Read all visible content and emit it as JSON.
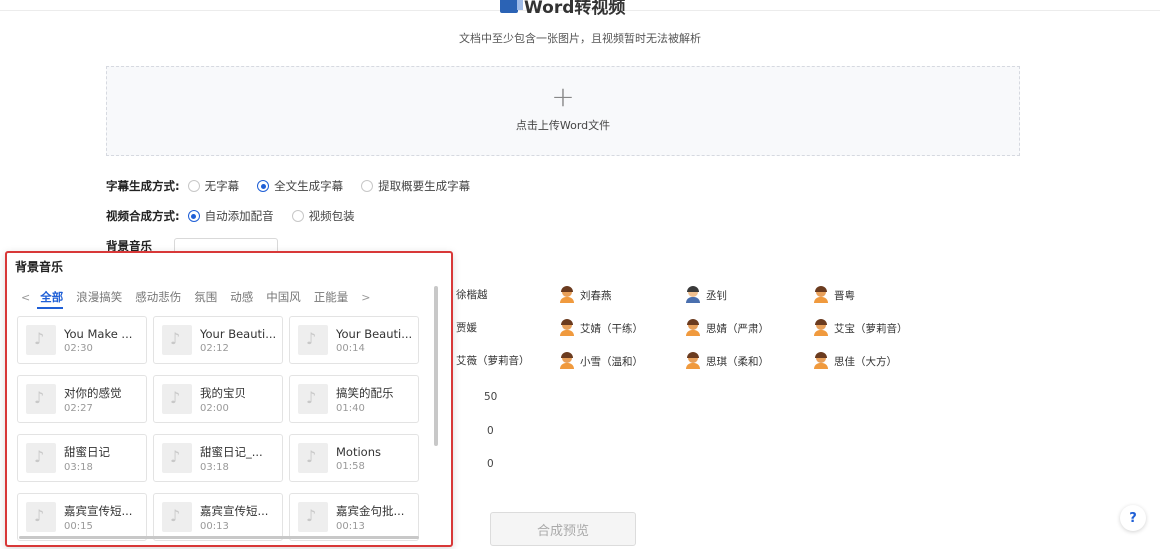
{
  "header": {
    "title": "Word转视频",
    "subtitle": "文档中至少包含一张图片，且视频暂时无法被解析"
  },
  "upload": {
    "plus": "+",
    "label": "点击上传Word文件"
  },
  "subtitle_mode": {
    "label": "字幕生成方式:",
    "options": [
      "无字幕",
      "全文生成字幕",
      "提取概要生成字幕"
    ],
    "selected": "全文生成字幕"
  },
  "video_mode": {
    "label": "视频合成方式:",
    "options": [
      "自动添加配音",
      "视频包装"
    ],
    "selected": "自动添加配音"
  },
  "background_music": {
    "label": "背景音乐"
  },
  "voices": {
    "rows": [
      [
        "徐楷越",
        "刘春燕",
        "丞钊",
        "晋粤"
      ],
      [
        "贾媛",
        "艾婧（干练）",
        "思婧（严肃）",
        "艾宝（萝莉音）"
      ],
      [
        "艾薇（萝莉音）",
        "小雪（温和）",
        "思琪（柔和）",
        "思佳（大方）"
      ]
    ]
  },
  "params": [
    "50",
    "0",
    "0"
  ],
  "preview_button": "合成预览",
  "help_button": "?",
  "music_popup": {
    "title": "背景音乐",
    "prev_arrow": "<",
    "next_arrow": ">",
    "categories": [
      "全部",
      "浪漫搞笑",
      "感动悲伤",
      "氛围",
      "动感",
      "中国风",
      "正能量"
    ],
    "active_category": "全部",
    "tracks": [
      {
        "name": "You Make ...",
        "duration": "02:30"
      },
      {
        "name": "Your Beauti...",
        "duration": "02:12"
      },
      {
        "name": "Your Beauti...",
        "duration": "00:14"
      },
      {
        "name": "对你的感觉",
        "duration": "02:27"
      },
      {
        "name": "我的宝贝",
        "duration": "02:00"
      },
      {
        "name": "搞笑的配乐",
        "duration": "01:40"
      },
      {
        "name": "甜蜜日记",
        "duration": "03:18"
      },
      {
        "name": "甜蜜日记_...",
        "duration": "03:18"
      },
      {
        "name": "Motions",
        "duration": "01:58"
      },
      {
        "name": "嘉宾宣传短...",
        "duration": "00:15"
      },
      {
        "name": "嘉宾宣传短...",
        "duration": "00:13"
      },
      {
        "name": "嘉宾金句批...",
        "duration": "00:13"
      }
    ]
  }
}
